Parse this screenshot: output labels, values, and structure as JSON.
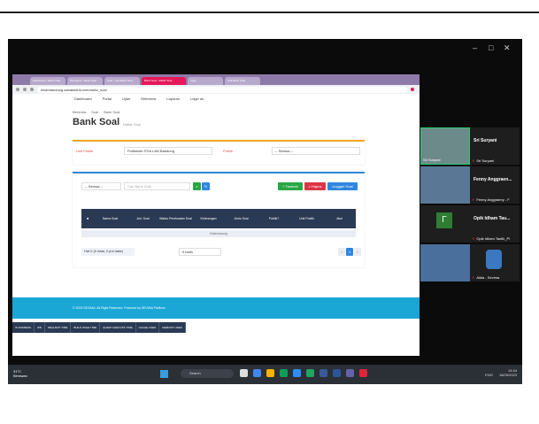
{
  "window_controls": {
    "minimize": "–",
    "maximize": "□",
    "close": "✕"
  },
  "browser": {
    "tabs": [
      "Dashboard - Bank Soal",
      "Persiapan - Bank Soal",
      "Soal - Unit Bank Soal",
      "Bank Soal - Daftar Soal",
      "Ujian",
      "Unit Bank Soal"
    ],
    "url": "elsdedandung.sabakedua.com/sisfo/_soal"
  },
  "app_nav": [
    "Dashboard",
    "Portal",
    "Ujian",
    "Referensi",
    "Laporan",
    "Login as"
  ],
  "breadcrumb": [
    "Beranda",
    "Soal",
    "Bank Soal"
  ],
  "page": {
    "title": "Bank Soal",
    "subtitle": "Daftar Soal"
  },
  "filters": {
    "unit_label": "Unit Publik",
    "unit_value": "Politeknik STIA LAN Bandung",
    "publik_label": "Publik",
    "publik_value": "-- Semua --"
  },
  "toolbar": {
    "type_select": "-- Semua --",
    "search_placeholder": "Cari Bank Soal",
    "add_label": "+ Tambah",
    "delete_label": "× Hapus",
    "import_label": "Unggah Soal"
  },
  "table": {
    "headers": [
      "Nama Soal",
      "Jml. Soal",
      "Waktu Pembuatan Soal",
      "Keterangan",
      "Jenis Soal",
      "Publik?",
      "Unit Publik",
      "Aksi"
    ],
    "empty_text": "Data kosong"
  },
  "pagination": {
    "info": "Hal 0 (0 data, 0 jml data)",
    "per_page": "0 baris",
    "page_number": "1"
  },
  "footer": {
    "copyright": "© 2023 SEVIMA. All Right Reserved. Powered by SEVIMA Platform"
  },
  "debug_bar": [
    "IP ADDRESS",
    "WR",
    "REQUEST TIME",
    "BUILD PAGE TIME",
    "QUERY EXECUTE TIME",
    "CACHE USED",
    "MEMORY USED"
  ],
  "participants": [
    {
      "name": "Sri Suryani",
      "label": "Sri Suryani"
    },
    {
      "name": "Fenny Anggraen...",
      "label": "Fenny Anggraeny - F"
    },
    {
      "name": "Opik Idham Tau...",
      "label": "Opik Idham Taufik_Pl"
    },
    {
      "name": "",
      "label": "Aldia - Sevima"
    }
  ],
  "taskbar": {
    "weather_temp": "31°C",
    "weather_desc": "Berawan",
    "search_label": "Search",
    "time": "14:44",
    "date": "18/05/2023",
    "lang": "ENG"
  }
}
